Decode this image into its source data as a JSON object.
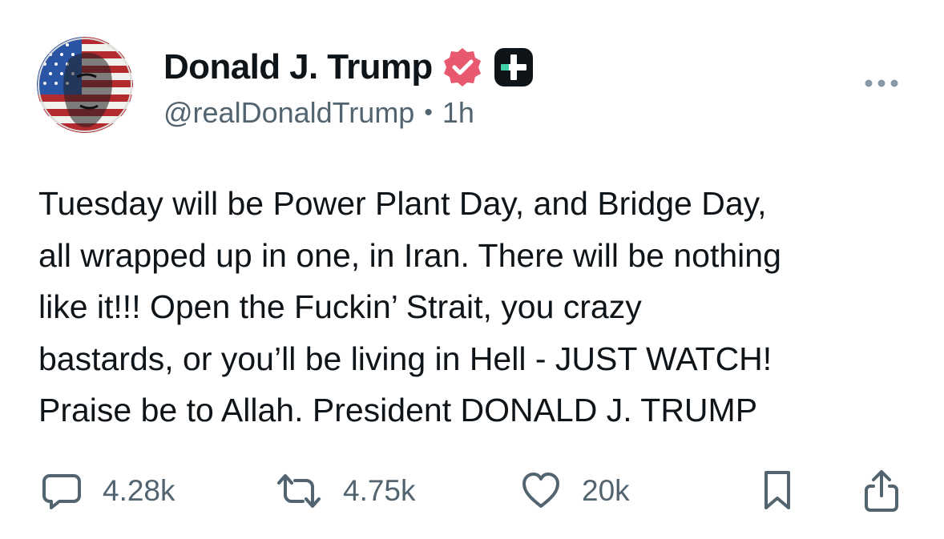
{
  "post": {
    "author": {
      "display_name": "Donald J. Trump",
      "handle": "@realDonaldTrump",
      "time": "1h",
      "separator": "•",
      "avatar_icon": "flag-portrait-avatar",
      "verified_icon": "verified-badge-icon",
      "plus_badge_icon": "plus-badge-icon",
      "verified_color": "#E8586F"
    },
    "menu_icon": "more-horizontal-icon",
    "text": "Tuesday will be Power Plant Day, and Bridge Day,\nall wrapped up in one, in Iran. There will be nothing\nlike it!!! Open the Fuckin’ Strait, you crazy\nbastards, or you’ll be living in Hell - JUST WATCH!\nPraise be to Allah. President DONALD J. TRUMP",
    "actions": {
      "replies": {
        "icon": "reply-icon",
        "count": "4.28k"
      },
      "reposts": {
        "icon": "repost-icon",
        "count": "4.75k"
      },
      "likes": {
        "icon": "heart-icon",
        "count": "20k"
      },
      "bookmark": {
        "icon": "bookmark-icon"
      },
      "share": {
        "icon": "share-icon"
      }
    }
  }
}
